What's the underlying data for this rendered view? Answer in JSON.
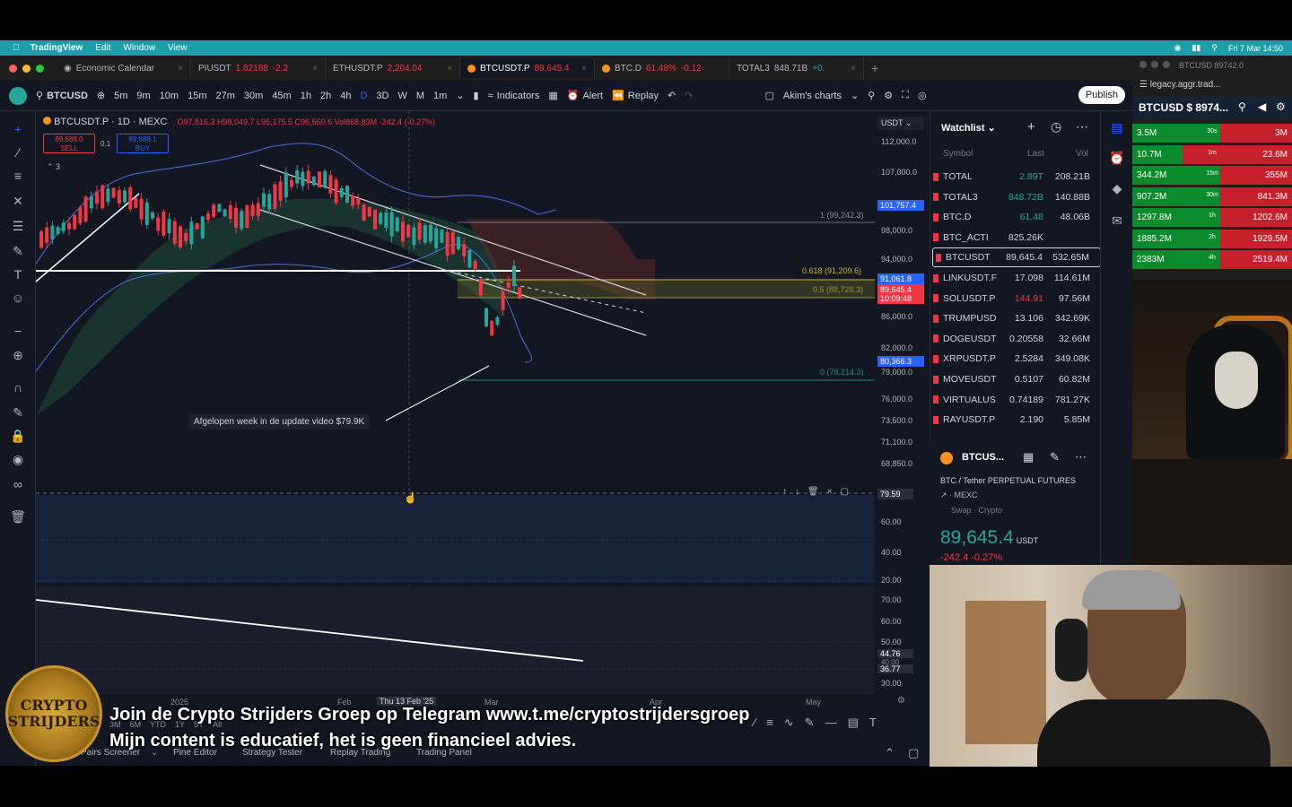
{
  "menubar": {
    "app": "TradingView",
    "items": [
      "Edit",
      "Window",
      "View"
    ],
    "clock": "Fri 7 Mar  14:50"
  },
  "tabs": [
    {
      "label": "Economic Calendar",
      "price": "",
      "change": ""
    },
    {
      "label": "PIUSDT",
      "price": "1.82188",
      "change": "-2.2"
    },
    {
      "label": "ETHUSDT.P",
      "price": "2,204.04",
      "change": "-"
    },
    {
      "label": "BTCUSDT.P",
      "price": "89,645.4",
      "change": "-"
    },
    {
      "label": "BTC.D",
      "price": "61.48%",
      "change": "-0.12"
    },
    {
      "label": "TOTAL3",
      "price": "848.71B",
      "change": "+0."
    }
  ],
  "toolbar": {
    "symbol": "BTCUSD",
    "intervals": [
      "5m",
      "9m",
      "10m",
      "15m",
      "27m",
      "30m",
      "45m",
      "1h",
      "2h",
      "4h",
      "D",
      "3D",
      "W",
      "M",
      "1m"
    ],
    "indicators": "Indicators",
    "alert": "Alert",
    "replay": "Replay",
    "layout_name": "Akim's charts",
    "publish": "Publish"
  },
  "chart": {
    "symbol_line": "BTCUSDT.P · 1D · MEXC",
    "ohlc": "O97,816.3 H98,049.7 L95,175.5 C96,560.6 Vol868.83M -242.4 (-0.27%)",
    "sell_price": "89,688.0",
    "sell_label": "SELL",
    "spread": "0.1",
    "buy_price": "89,688.1",
    "buy_label": "BUY",
    "collapse": "3",
    "currency": "USDT",
    "price_axis": [
      "112,000.0",
      "107,000.0",
      "98,000.0",
      "94,000.0",
      "86,000.0",
      "82,000.0",
      "79,000.0",
      "76,000.0",
      "73,500.0",
      "71,100.0",
      "68,850.0"
    ],
    "price_labels": {
      "blue_top": "101,757.4",
      "blue_mid": "91,061.8",
      "red_price": "89,645.4",
      "red_timer": "10:09:48",
      "blue_low": "80,366.3"
    },
    "fib": {
      "f1": "1 (99,242.3)",
      "f618": "0.618 (91,209.6)",
      "f05": "0.5 (88,728.3)",
      "f0": "0 (78,214.3)"
    },
    "annotation": "Afgelopen week in de update video $79.9K",
    "osc1_axis": [
      "79.59",
      "60.00",
      "40.00",
      "20.00"
    ],
    "osc2_axis": [
      "70.00",
      "60.00",
      "50.00",
      "44.76",
      "40.00",
      "36.77",
      "30.00"
    ],
    "time_axis": [
      "2025",
      "Feb",
      "Thu 13 Feb '25",
      "Mar",
      "Apr",
      "May"
    ],
    "ranges": [
      "3M",
      "6M",
      "YTD",
      "1Y",
      "5Y",
      "All"
    ]
  },
  "bottom_panel": [
    "Pairs Screener",
    "Pine Editor",
    "Strategy Tester",
    "Replay Trading",
    "Trading Panel"
  ],
  "watchlist": {
    "title": "Watchlist",
    "columns": [
      "Symbol",
      "Last",
      "Vol"
    ],
    "rows": [
      {
        "symbol": "TOTAL",
        "last": "2.89T",
        "vol": "208.21B",
        "color": "#26a69a"
      },
      {
        "symbol": "TOTAL3",
        "last": "848.72B",
        "vol": "140.88B",
        "color": "#26a69a"
      },
      {
        "symbol": "BTC.D",
        "last": "61.48",
        "vol": "48.06B",
        "color": "#26a69a"
      },
      {
        "symbol": "BTC_ACTI",
        "last": "825.26K",
        "vol": "",
        "color": "#d1d4dc"
      },
      {
        "symbol": "BTCUSDT",
        "last": "89,645.4",
        "vol": "532.65M",
        "color": "#d1d4dc"
      },
      {
        "symbol": "LINKUSDT.F",
        "last": "17.098",
        "vol": "114.61M",
        "color": "#d1d4dc"
      },
      {
        "symbol": "SOLUSDT.P",
        "last": "144.91",
        "vol": "97.56M",
        "color": "#f23645"
      },
      {
        "symbol": "TRUMPUSD",
        "last": "13.106",
        "vol": "342.69K",
        "color": "#d1d4dc"
      },
      {
        "symbol": "DOGEUSDT",
        "last": "0.20558",
        "vol": "32.66M",
        "color": "#d1d4dc"
      },
      {
        "symbol": "XRPUSDT.P",
        "last": "2.5284",
        "vol": "349.08K",
        "color": "#d1d4dc"
      },
      {
        "symbol": "MOVEUSDT",
        "last": "0.5107",
        "vol": "60.82M",
        "color": "#d1d4dc"
      },
      {
        "symbol": "VIRTUALUS",
        "last": "0.74189",
        "vol": "781.27K",
        "color": "#d1d4dc"
      },
      {
        "symbol": "RAYUSDT.P",
        "last": "2.190",
        "vol": "5.85M",
        "color": "#d1d4dc"
      }
    ]
  },
  "detail": {
    "symbol": "BTCUS...",
    "name": "BTC / Tether PERPETUAL FUTURES",
    "exchange": "MEXC",
    "type": "Swap · Crypto",
    "price": "89,645.4",
    "currency": "USDT",
    "change": "-242.4  -0.27%"
  },
  "side_window": {
    "title": "BTCUSD 89742.0",
    "url": "legacy.aggr.trad...",
    "ticker": "BTCUSD $ 8974...",
    "rows": [
      {
        "left": "3.5M",
        "tf": "30s",
        "right": "3M"
      },
      {
        "left": "10.7M",
        "tf": "1m",
        "right": "23.6M"
      },
      {
        "left": "344.2M",
        "tf": "15m",
        "right": "355M"
      },
      {
        "left": "907.2M",
        "tf": "30m",
        "right": "841.3M"
      },
      {
        "left": "1297.8M",
        "tf": "1h",
        "right": "1202.6M"
      },
      {
        "left": "1885.2M",
        "tf": "2h",
        "right": "1929.5M"
      },
      {
        "left": "2383M",
        "tf": "4h",
        "right": "2519.4M"
      }
    ]
  },
  "captions": {
    "line1": "Join de Crypto Strijders Groep op Telegram www.t.me/cryptostrijdersgroep",
    "line2": "Mijn content is educatief, het is geen financieel advies."
  },
  "logo": {
    "line1": "CRYPTO",
    "line2": "STRIJDERS"
  }
}
